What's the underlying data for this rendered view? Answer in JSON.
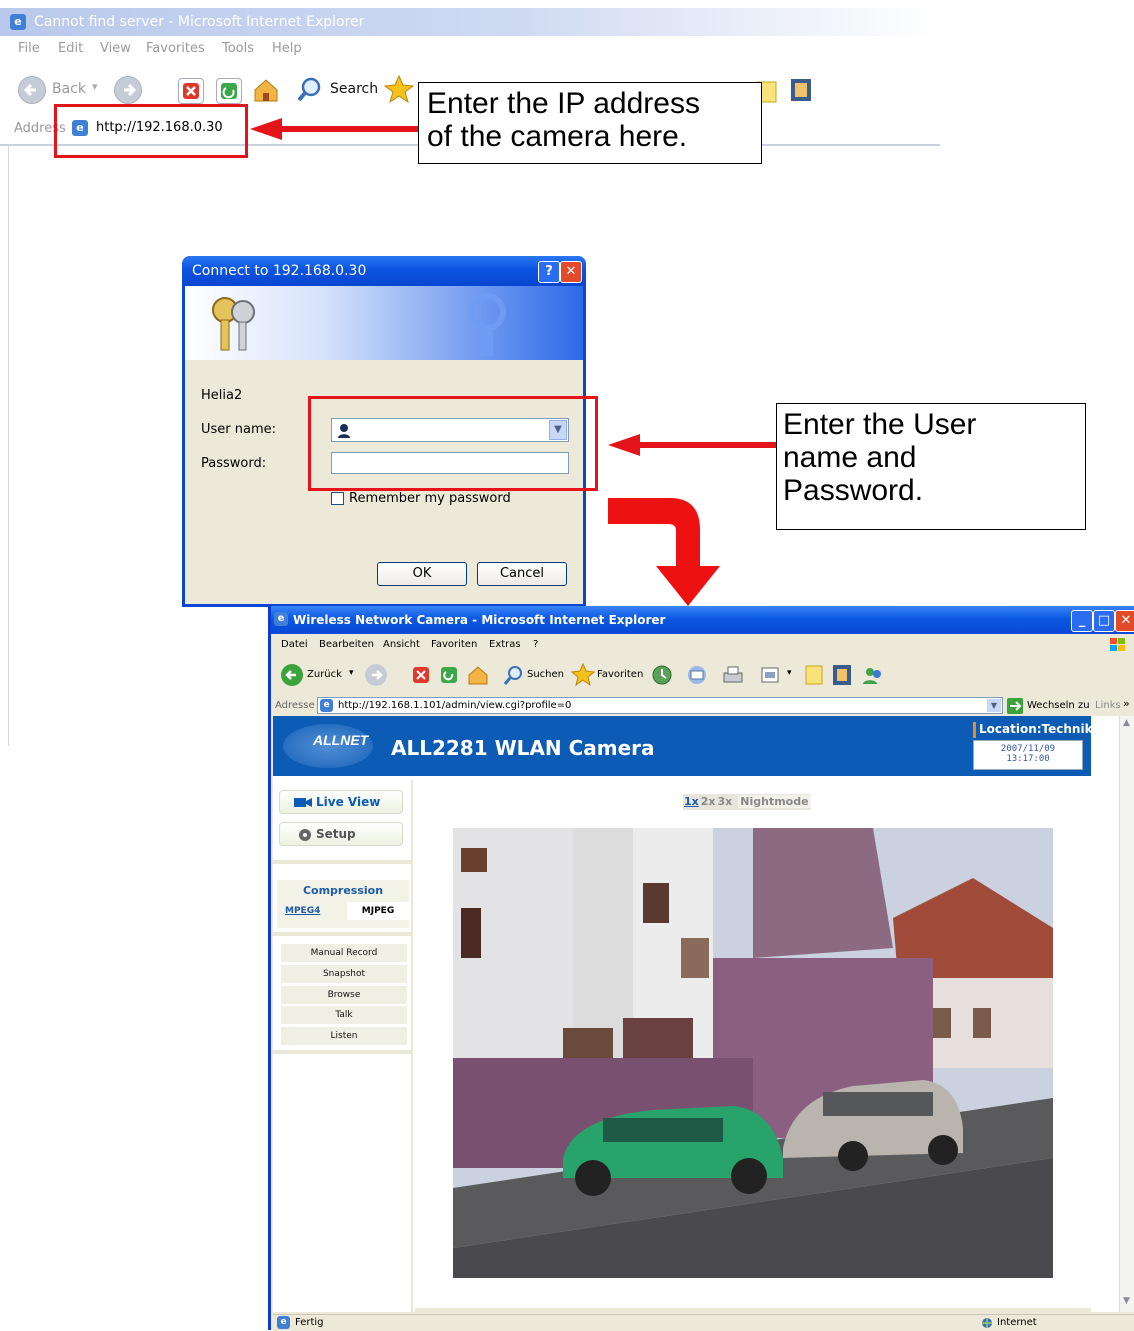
{
  "background_window": {
    "title": "Cannot find server - Microsoft Internet Explorer",
    "menu": [
      "File",
      "Edit",
      "View",
      "Favorites",
      "Tools",
      "Help"
    ],
    "toolbar": {
      "back_label": "Back",
      "search_label": "Search"
    },
    "address_label": "Address",
    "url": "http://192.168.0.30"
  },
  "callouts": {
    "ip_note": [
      "Enter the IP address",
      "of the camera here."
    ],
    "credentials_note": [
      "Enter the User",
      "name and",
      "Password."
    ]
  },
  "login_dialog": {
    "title": "Connect to 192.168.0.30",
    "help_glyph": "?",
    "close_glyph": "✕",
    "realm": "Helia2",
    "username_label": "User name:",
    "username_value": "",
    "password_label": "Password:",
    "password_value": "",
    "remember_label": "Remember my password",
    "remember_checked": false,
    "ok_label": "OK",
    "cancel_label": "Cancel"
  },
  "camera_window": {
    "title": "Wireless Network Camera - Microsoft Internet Explorer",
    "menu": [
      "Datei",
      "Bearbeiten",
      "Ansicht",
      "Favoriten",
      "Extras",
      "?"
    ],
    "toolbar": {
      "back_label": "Zurück",
      "search_label": "Suchen",
      "favorites_label": "Favoriten"
    },
    "address_label": "Adresse",
    "url": "http://192.168.1.101/admin/view.cgi?profile=0",
    "go_label": "Wechseln zu",
    "links_label": "Links",
    "status_text": "Fertig",
    "zone_text": "Internet"
  },
  "camera_page": {
    "brand": "ALLNET",
    "product_title": "ALL2281 WLAN Camera",
    "location": "Location:Technik",
    "date": "2007/11/09",
    "time": "13:17:00",
    "nav": [
      "Live View",
      "Setup"
    ],
    "compression_heading": "Compression",
    "compression_options": [
      "MPEG4",
      "MJPEG"
    ],
    "actions": [
      "Manual Record",
      "Snapshot",
      "Browse",
      "Talk",
      "Listen"
    ],
    "zoom_options": [
      "1x",
      "2x",
      "3x"
    ],
    "nightmode_label": "Nightmode"
  },
  "colors": {
    "callout_red": "#e4141a",
    "xp_title_blue": "#0b54e1",
    "allnet_header_blue": "#0c5cb6",
    "dialog_face": "#ece9d8"
  }
}
